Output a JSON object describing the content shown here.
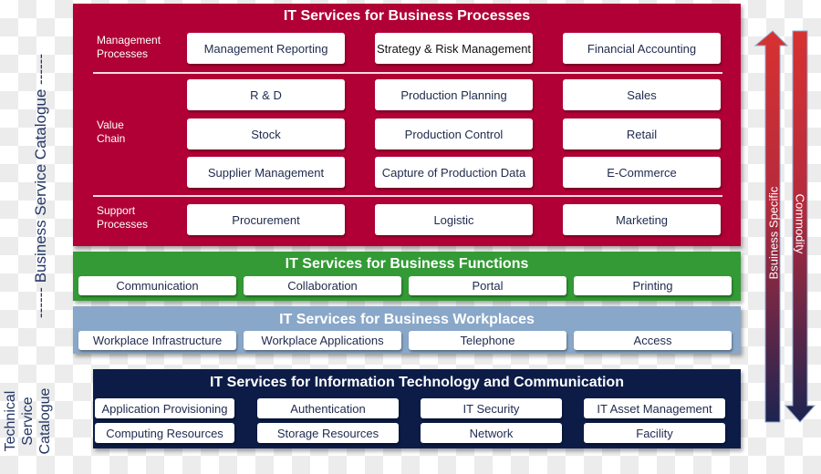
{
  "side_labels": {
    "business": "------ Business Service Catalogue ------",
    "technical": [
      "Technical",
      "Service",
      "Catalogue"
    ]
  },
  "business_processes": {
    "title": "IT Services for Business Processes",
    "color": "#b00035",
    "groups": [
      {
        "label": [
          "Management",
          "Processes"
        ],
        "rows": [
          [
            "Management Reporting",
            "Strategy & Risk Management",
            "Financial Accounting"
          ]
        ]
      },
      {
        "label": [
          "Value",
          "Chain"
        ],
        "rows": [
          [
            "R & D",
            "Production Planning",
            "Sales"
          ],
          [
            "Stock",
            "Production Control",
            "Retail"
          ],
          [
            "Supplier Management",
            "Capture of Production Data",
            "E-Commerce"
          ]
        ]
      },
      {
        "label": [
          "Support",
          "Processes"
        ],
        "rows": [
          [
            "Procurement",
            "Logistic",
            "Marketing"
          ]
        ]
      }
    ]
  },
  "business_functions": {
    "title": "IT Services for Business Functions",
    "color": "#339a35",
    "items": [
      "Communication",
      "Collaboration",
      "Portal",
      "Printing"
    ]
  },
  "business_workplaces": {
    "title": "IT Services for Business Workplaces",
    "color": "#89a7c8",
    "items": [
      "Workplace Infrastructure",
      "Workplace Applications",
      "Telephone",
      "Access"
    ]
  },
  "ict": {
    "title": "IT Services  for Information Technology and Communication",
    "color": "#0c1c47",
    "rows": [
      [
        "Application Provisioning",
        "Authentication",
        "IT Security",
        "IT Asset Management"
      ],
      [
        "Computing Resources",
        "Storage Resources",
        "Network",
        "Facility"
      ]
    ]
  },
  "arrows": {
    "up_label": "Bsuiness Specific",
    "down_label": "Commodity",
    "top_color": "#d63232",
    "bottom_color": "#1c2450"
  }
}
